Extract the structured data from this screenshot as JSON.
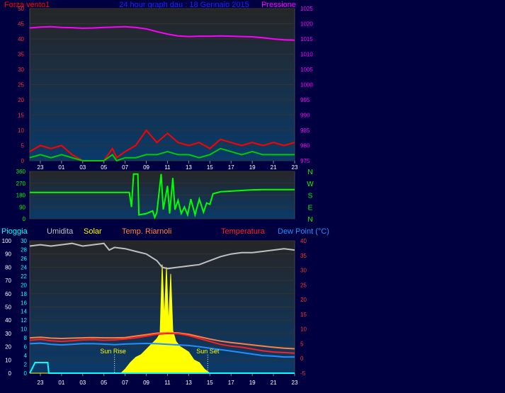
{
  "header": {
    "left_label": "Forza vento1",
    "title": "24 hour graph dau : 18 Gennaio 2015",
    "right_label": "Pressione"
  },
  "wind_panel_labels": [
    "N",
    "W",
    "S",
    "E",
    "N"
  ],
  "legend": {
    "pioggia": "Pioggia",
    "umidita": "Umidita",
    "solar": "Solar",
    "temp_riarnoli": "Temp. Riarnoli",
    "temperatura": "Temperatura",
    "dew_point": "Dew Point (°C)"
  },
  "annotations": {
    "sun_rise": "Sun Rise",
    "sun_set": "Sun Set"
  },
  "colors": {
    "background": "#000040",
    "wind": "#ff0000",
    "gust": "#00cc00",
    "pressure": "#ff00ff",
    "direction": "#00ff00",
    "humidity": "#c0c0c0",
    "solar": "#ffff00",
    "temperature": "#ff2020",
    "temp_riarnoli": "#ff8040",
    "dew_point": "#2090ff",
    "rain": "#00ffff"
  },
  "chart_data": [
    {
      "type": "line",
      "name": "wind-pressure",
      "x_ticks": [
        "23",
        "01",
        "03",
        "05",
        "07",
        "09",
        "11",
        "13",
        "15",
        "17",
        "19",
        "21",
        "23"
      ],
      "left_axis": {
        "ticks": [
          0,
          5,
          10,
          15,
          20,
          25,
          30,
          35,
          40,
          45,
          50
        ],
        "range": [
          0,
          50
        ]
      },
      "right_axis": {
        "ticks": [
          975,
          980,
          985,
          990,
          995,
          1000,
          1005,
          1010,
          1015,
          1020,
          1025
        ],
        "range": [
          975,
          1025
        ]
      },
      "x_range": [
        0,
        25
      ],
      "pressure": [
        [
          0,
          1018.6
        ],
        [
          1,
          1018.9
        ],
        [
          2,
          1019.0
        ],
        [
          3,
          1018.8
        ],
        [
          4,
          1018.7
        ],
        [
          5,
          1018.5
        ],
        [
          6,
          1018.6
        ],
        [
          7,
          1018.8
        ],
        [
          8,
          1018.9
        ],
        [
          9,
          1019.0
        ],
        [
          10,
          1018.8
        ],
        [
          11,
          1018.3
        ],
        [
          12,
          1017.4
        ],
        [
          13,
          1016.6
        ],
        [
          14,
          1016.0
        ],
        [
          15,
          1015.8
        ],
        [
          16,
          1015.9
        ],
        [
          17,
          1015.9
        ],
        [
          18,
          1016.0
        ],
        [
          19,
          1015.9
        ],
        [
          20,
          1015.8
        ],
        [
          21,
          1015.7
        ],
        [
          22,
          1015.4
        ],
        [
          23,
          1015.0
        ],
        [
          24,
          1014.7
        ],
        [
          25,
          1014.6
        ]
      ],
      "wind_max": [
        [
          0,
          3
        ],
        [
          1,
          5
        ],
        [
          2,
          4
        ],
        [
          3,
          5
        ],
        [
          4,
          2
        ],
        [
          5,
          0
        ],
        [
          6,
          0
        ],
        [
          7,
          0
        ],
        [
          7.8,
          4
        ],
        [
          8.2,
          1
        ],
        [
          9,
          3
        ],
        [
          10,
          5
        ],
        [
          11,
          10
        ],
        [
          12,
          6
        ],
        [
          13,
          9
        ],
        [
          14,
          6
        ],
        [
          15,
          5
        ],
        [
          16,
          6
        ],
        [
          17,
          4
        ],
        [
          18,
          7
        ],
        [
          19,
          6
        ],
        [
          20,
          5
        ],
        [
          21,
          6
        ],
        [
          22,
          5
        ],
        [
          23,
          6
        ],
        [
          24,
          5
        ],
        [
          25,
          6
        ]
      ],
      "wind_avg": [
        [
          0,
          1
        ],
        [
          1,
          2
        ],
        [
          2,
          1
        ],
        [
          3,
          2
        ],
        [
          4,
          1
        ],
        [
          5,
          0
        ],
        [
          6,
          0
        ],
        [
          7,
          0
        ],
        [
          7.8,
          2
        ],
        [
          8.2,
          0
        ],
        [
          9,
          1
        ],
        [
          10,
          1
        ],
        [
          11,
          2
        ],
        [
          12,
          2
        ],
        [
          13,
          3
        ],
        [
          14,
          2
        ],
        [
          15,
          2
        ],
        [
          16,
          1
        ],
        [
          17,
          2
        ],
        [
          18,
          4
        ],
        [
          19,
          3
        ],
        [
          20,
          2
        ],
        [
          21,
          3
        ],
        [
          22,
          2
        ],
        [
          23,
          2
        ],
        [
          24,
          2
        ],
        [
          25,
          2
        ]
      ]
    },
    {
      "type": "line",
      "name": "wind-direction",
      "y_ticks": [
        0,
        90,
        180,
        270,
        360
      ],
      "y_range": [
        0,
        360
      ],
      "direction": [
        [
          0,
          200
        ],
        [
          9,
          200
        ],
        [
          9.4,
          200
        ],
        [
          9.6,
          90
        ],
        [
          9.8,
          340
        ],
        [
          10.2,
          340
        ],
        [
          10.3,
          30
        ],
        [
          11,
          40
        ],
        [
          11.6,
          60
        ],
        [
          11.8,
          10
        ],
        [
          12,
          50
        ],
        [
          12.4,
          340
        ],
        [
          12.6,
          70
        ],
        [
          13,
          250
        ],
        [
          13.2,
          40
        ],
        [
          13.5,
          310
        ],
        [
          13.7,
          70
        ],
        [
          14,
          140
        ],
        [
          14.3,
          40
        ],
        [
          14.6,
          90
        ],
        [
          14.9,
          30
        ],
        [
          15.2,
          150
        ],
        [
          15.6,
          30
        ],
        [
          16,
          150
        ],
        [
          16.4,
          50
        ],
        [
          16.7,
          120
        ],
        [
          17,
          110
        ],
        [
          17.3,
          190
        ],
        [
          18,
          205
        ],
        [
          19,
          210
        ],
        [
          20,
          215
        ],
        [
          21,
          220
        ],
        [
          22,
          222
        ],
        [
          25,
          222
        ]
      ]
    },
    {
      "type": "line",
      "name": "temperature-humidity",
      "x_ticks": [
        "23",
        "01",
        "03",
        "05",
        "07",
        "09",
        "11",
        "13",
        "15",
        "17",
        "19",
        "21",
        "23"
      ],
      "humidity_axis": {
        "ticks": [
          0,
          10,
          20,
          30,
          40,
          50,
          60,
          70,
          80,
          90,
          100
        ],
        "range": [
          0,
          100
        ]
      },
      "rain_axis": {
        "ticks": [
          0,
          2,
          4,
          6,
          8,
          10,
          12,
          14,
          16,
          18,
          20,
          22,
          24,
          26,
          28,
          30
        ]
      },
      "temperature_axis": {
        "ticks": [
          -5,
          0,
          5,
          10,
          15,
          20,
          25,
          30,
          35,
          40
        ],
        "range": [
          -5,
          40
        ]
      },
      "humidity": [
        [
          0,
          96
        ],
        [
          1,
          97
        ],
        [
          2,
          96
        ],
        [
          3,
          97
        ],
        [
          4,
          98
        ],
        [
          5,
          96
        ],
        [
          6,
          97
        ],
        [
          7,
          98
        ],
        [
          7.5,
          93
        ],
        [
          8,
          95
        ],
        [
          9,
          94
        ],
        [
          10,
          92
        ],
        [
          11,
          90
        ],
        [
          12,
          85
        ],
        [
          12.5,
          80
        ],
        [
          13,
          79
        ],
        [
          14,
          80
        ],
        [
          15,
          81
        ],
        [
          16,
          82
        ],
        [
          17,
          85
        ],
        [
          18,
          88
        ],
        [
          19,
          90
        ],
        [
          20,
          91
        ],
        [
          21,
          91
        ],
        [
          22,
          92
        ],
        [
          23,
          93
        ],
        [
          24,
          94
        ],
        [
          25,
          93
        ]
      ],
      "temperature": [
        [
          0,
          6.2
        ],
        [
          1,
          6.5
        ],
        [
          2,
          6.0
        ],
        [
          3,
          5.8
        ],
        [
          4,
          6.0
        ],
        [
          5,
          6.3
        ],
        [
          6,
          6.4
        ],
        [
          7,
          6.2
        ],
        [
          8,
          6.3
        ],
        [
          9,
          6.6
        ],
        [
          10,
          7.0
        ],
        [
          11,
          7.6
        ],
        [
          12,
          8.2
        ],
        [
          13,
          8.5
        ],
        [
          14,
          8.4
        ],
        [
          15,
          7.8
        ],
        [
          16,
          6.8
        ],
        [
          17,
          5.8
        ],
        [
          18,
          4.8
        ],
        [
          19,
          4.2
        ],
        [
          20,
          3.8
        ],
        [
          21,
          3.2
        ],
        [
          22,
          2.6
        ],
        [
          23,
          2.2
        ],
        [
          24,
          2.0
        ],
        [
          25,
          1.8
        ]
      ],
      "temp_riarnoli": [
        [
          0,
          7.0
        ],
        [
          1,
          7.2
        ],
        [
          2,
          6.9
        ],
        [
          3,
          6.8
        ],
        [
          4,
          6.9
        ],
        [
          5,
          7.0
        ],
        [
          6,
          7.1
        ],
        [
          7,
          7.0
        ],
        [
          8,
          7.0
        ],
        [
          9,
          7.1
        ],
        [
          10,
          7.6
        ],
        [
          11,
          8.1
        ],
        [
          12,
          8.6
        ],
        [
          13,
          8.8
        ],
        [
          14,
          8.7
        ],
        [
          15,
          8.2
        ],
        [
          16,
          7.4
        ],
        [
          17,
          6.6
        ],
        [
          18,
          5.9
        ],
        [
          19,
          5.4
        ],
        [
          20,
          5.0
        ],
        [
          21,
          4.6
        ],
        [
          22,
          4.2
        ],
        [
          23,
          3.8
        ],
        [
          24,
          3.5
        ],
        [
          25,
          3.3
        ]
      ],
      "dew_point": [
        [
          0,
          5.0
        ],
        [
          1,
          5.2
        ],
        [
          2,
          4.8
        ],
        [
          3,
          4.6
        ],
        [
          4,
          4.8
        ],
        [
          5,
          5.0
        ],
        [
          6,
          5.0
        ],
        [
          7,
          4.9
        ],
        [
          8,
          4.7
        ],
        [
          9,
          4.9
        ],
        [
          10,
          5.0
        ],
        [
          11,
          5.1
        ],
        [
          12,
          5.0
        ],
        [
          13,
          4.8
        ],
        [
          14,
          4.6
        ],
        [
          15,
          4.4
        ],
        [
          16,
          4.0
        ],
        [
          17,
          3.5
        ],
        [
          18,
          3.0
        ],
        [
          19,
          2.5
        ],
        [
          20,
          2.0
        ],
        [
          21,
          1.5
        ],
        [
          22,
          1.0
        ],
        [
          23,
          0.8
        ],
        [
          24,
          0.5
        ],
        [
          25,
          0.5
        ]
      ],
      "solar": [
        [
          0,
          0
        ],
        [
          8.6,
          0
        ],
        [
          9,
          3
        ],
        [
          9.5,
          8
        ],
        [
          10,
          12
        ],
        [
          10.5,
          14
        ],
        [
          11,
          18
        ],
        [
          11.5,
          22
        ],
        [
          12,
          26
        ],
        [
          12.3,
          30
        ],
        [
          12.5,
          82
        ],
        [
          12.7,
          40
        ],
        [
          12.9,
          80
        ],
        [
          13.1,
          36
        ],
        [
          13.3,
          75
        ],
        [
          13.5,
          32
        ],
        [
          13.8,
          24
        ],
        [
          14.2,
          20
        ],
        [
          14.6,
          18
        ],
        [
          15,
          16
        ],
        [
          15.5,
          10
        ],
        [
          16,
          8
        ],
        [
          16.5,
          3
        ],
        [
          17,
          0
        ],
        [
          25,
          0
        ]
      ],
      "rain": [
        [
          0,
          0
        ],
        [
          0.5,
          8
        ],
        [
          1.7,
          8
        ],
        [
          1.8,
          0
        ],
        [
          25,
          0
        ]
      ],
      "sun_rise_x": 8.0,
      "sun_set_x": 16.8
    }
  ]
}
